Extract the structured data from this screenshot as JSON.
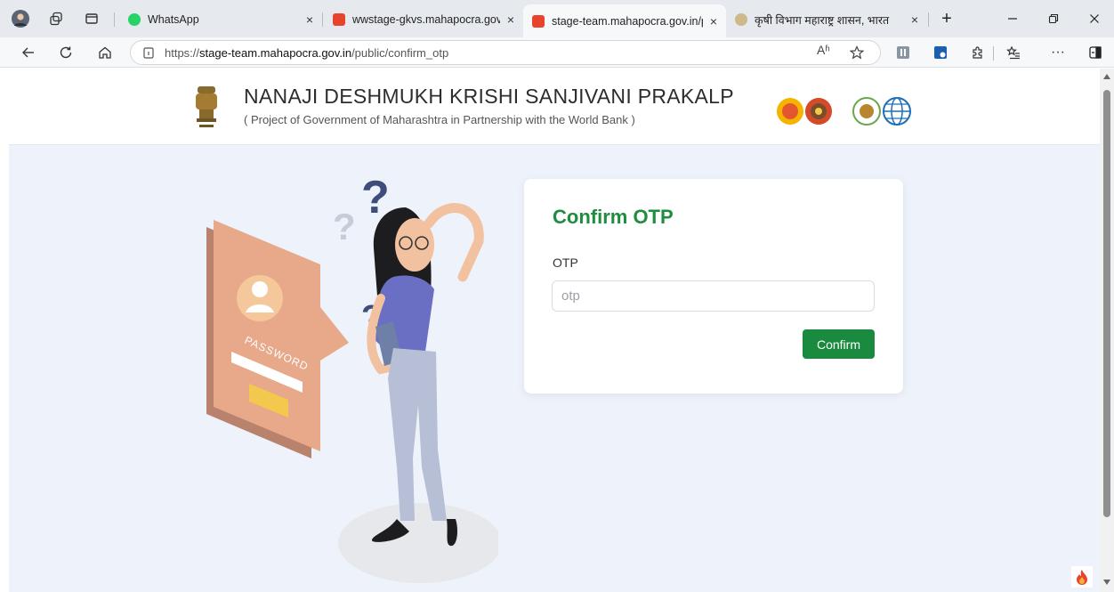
{
  "browser": {
    "tabs": [
      {
        "label": "WhatsApp",
        "close": "×"
      },
      {
        "label": "wwstage-gkvs.mahapocra.gov.in",
        "close": "×"
      },
      {
        "label": "stage-team.mahapocra.gov.in/pu",
        "close": "×",
        "active": true
      },
      {
        "label": "कृषी विभाग महाराष्ट्र शासन, भारत",
        "close": "×"
      }
    ],
    "new_tab": "+",
    "address": {
      "scheme": "https://",
      "host": "stage-team.mahapocra.gov.in",
      "path": "/public/confirm_otp"
    },
    "read_aloud": "Aʱ"
  },
  "site": {
    "title": "NANAJI DESHMUKH KRISHI SANJIVANI PRAKALP",
    "subtitle": "( Project of Government of Maharashtra in Partnership with the World Bank )"
  },
  "form": {
    "title": "Confirm OTP",
    "otp_label": "OTP",
    "otp_placeholder": "otp",
    "otp_value": "",
    "confirm_label": "Confirm"
  },
  "illustration": {
    "badge_text": "PASSWORD",
    "question_marks": "?"
  },
  "colors": {
    "accent_green": "#198a3e",
    "title_green": "#1e8e3e",
    "page_bg": "#eef3fb"
  }
}
